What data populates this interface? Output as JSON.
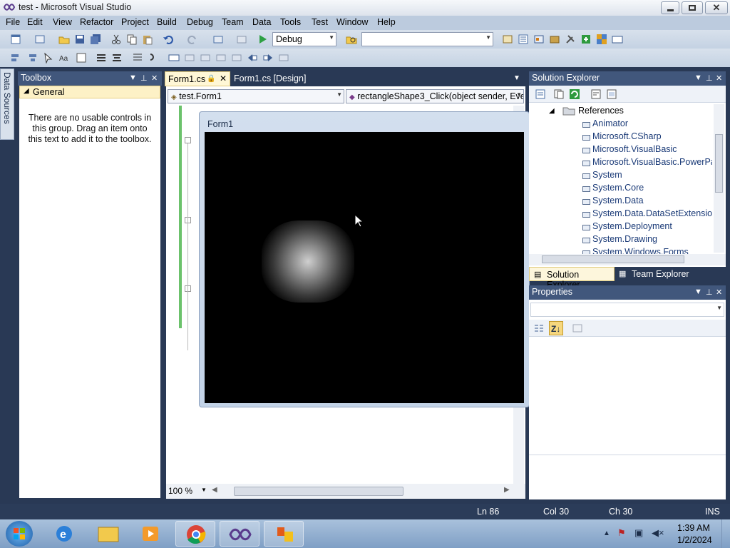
{
  "window": {
    "title": "test - Microsoft Visual Studio"
  },
  "menu": [
    "File",
    "Edit",
    "View",
    "Refactor",
    "Project",
    "Build",
    "Debug",
    "Team",
    "Data",
    "Tools",
    "Test",
    "Window",
    "Help"
  ],
  "toolbar": {
    "config_value": "Debug",
    "platform_value": ""
  },
  "side_tab": {
    "label": "Data Sources"
  },
  "toolbox": {
    "title": "Toolbox",
    "group": "General",
    "message": "There are no usable controls in this group. Drag an item onto this text to add it to the toolbox."
  },
  "doc_tabs": [
    {
      "label": "Form1.cs",
      "active": true
    },
    {
      "label": "Form1.cs [Design]",
      "active": false
    }
  ],
  "editor": {
    "class_combo": "test.Form1",
    "member_combo": "rectangleShape3_Click(object sender, Eve",
    "zoom": "100 %"
  },
  "form": {
    "title": "Form1"
  },
  "solution_explorer": {
    "title": "Solution Explorer",
    "folder": "References",
    "items": [
      "Animator",
      "Microsoft.CSharp",
      "Microsoft.VisualBasic",
      "Microsoft.VisualBasic.PowerPacks",
      "System",
      "System.Core",
      "System.Data",
      "System.Data.DataSetExtensions",
      "System.Deployment",
      "System.Drawing",
      "System.Windows.Forms"
    ],
    "tabs": [
      "Solution Explorer",
      "Team Explorer"
    ]
  },
  "properties": {
    "title": "Properties"
  },
  "status": {
    "ln": "Ln 86",
    "col": "Col 30",
    "ch": "Ch 30",
    "mode": "INS"
  },
  "clock": {
    "time": "1:39 AM",
    "date": "1/2/2024"
  }
}
